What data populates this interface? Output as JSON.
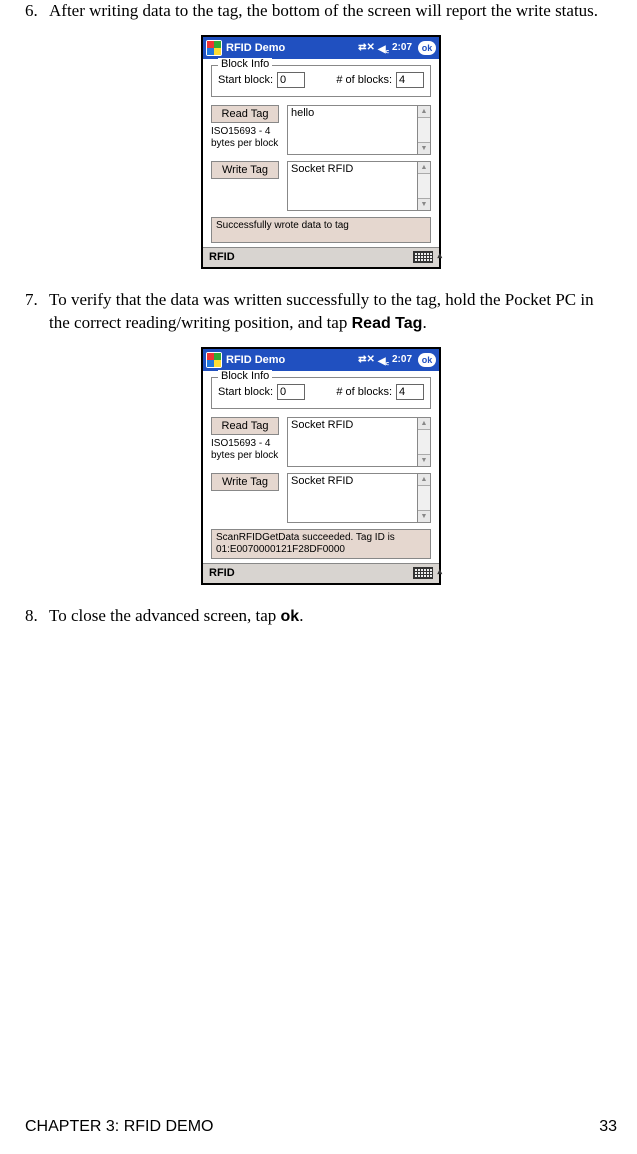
{
  "steps": {
    "s6": {
      "num": "6.",
      "text": "After writing data to the tag, the bottom of the screen will report the write status."
    },
    "s7": {
      "num": "7.",
      "prefix": "To verify that the data was written successfully to the tag, hold the Pocket PC in the correct reading/writing position, and tap ",
      "action": "Read Tag",
      "suffix": "."
    },
    "s8": {
      "num": "8.",
      "prefix": "To close the advanced screen, tap ",
      "action": "ok",
      "suffix": "."
    }
  },
  "shot1": {
    "title": "RFID Demo",
    "time": "2:07",
    "ok": "ok",
    "blockinfo_legend": "Block Info",
    "start_label": "Start block:",
    "start_value": "0",
    "num_label": "# of blocks:",
    "num_value": "4",
    "read_btn": "Read Tag",
    "taginfo": "ISO15693 - 4 bytes per block",
    "read_text": "hello",
    "write_btn": "Write Tag",
    "write_text": "Socket RFID",
    "status": "Successfully wrote data to tag",
    "footer": "RFID"
  },
  "shot2": {
    "title": "RFID Demo",
    "time": "2:07",
    "ok": "ok",
    "blockinfo_legend": "Block Info",
    "start_label": "Start block:",
    "start_value": "0",
    "num_label": "# of blocks:",
    "num_value": "4",
    "read_btn": "Read Tag",
    "taginfo": "ISO15693 - 4 bytes per block",
    "read_text": "Socket RFID",
    "write_btn": "Write Tag",
    "write_text": "Socket RFID",
    "status": "ScanRFIDGetData succeeded. Tag ID is 01:E0070000121F28DF0000",
    "footer": "RFID"
  },
  "footer": {
    "chapter": "CHAPTER 3: RFID DEMO",
    "page": "33"
  }
}
